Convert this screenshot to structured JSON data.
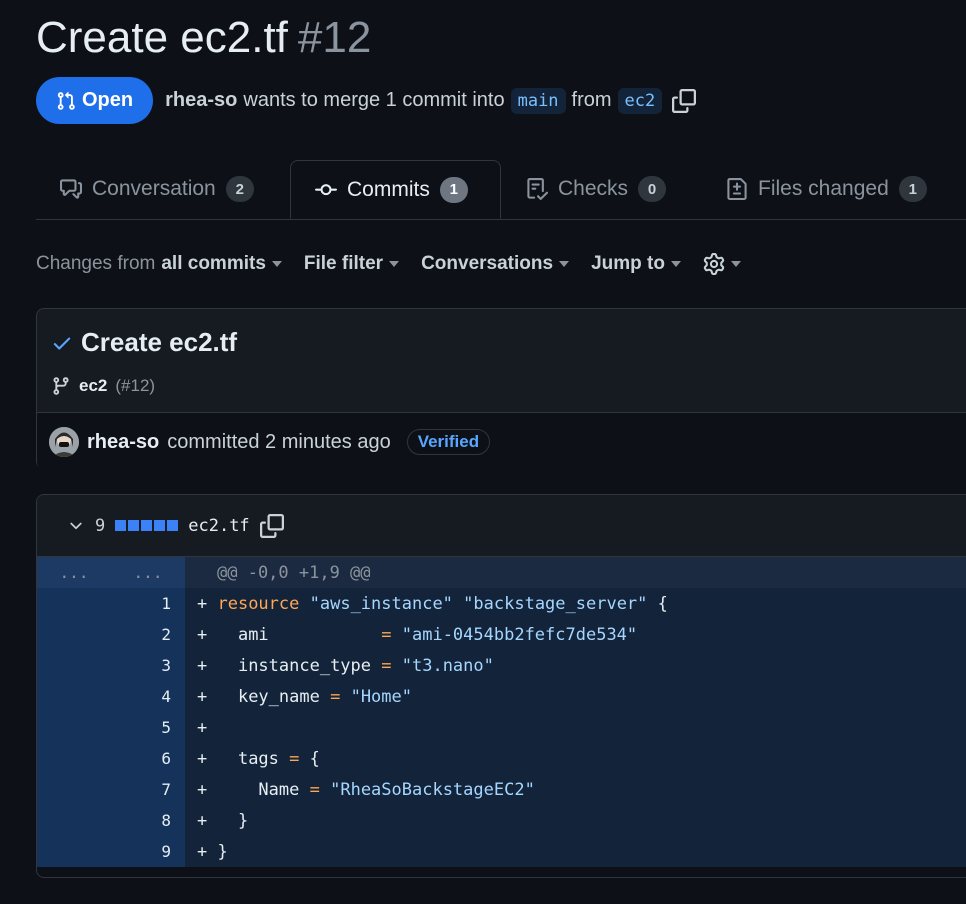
{
  "pr": {
    "title": "Create ec2.tf",
    "number": "#12",
    "state": "Open",
    "author": "rhea-so",
    "merge_text": "wants to merge 1 commit into",
    "base_branch": "main",
    "from_text": "from",
    "head_branch": "ec2"
  },
  "tabs": [
    {
      "label": "Conversation",
      "count": "2",
      "icon": "comment-icon"
    },
    {
      "label": "Commits",
      "count": "1",
      "icon": "commit-icon",
      "active": true
    },
    {
      "label": "Checks",
      "count": "0",
      "icon": "checklist-icon"
    },
    {
      "label": "Files changed",
      "count": "1",
      "icon": "file-diff-icon"
    }
  ],
  "filters": {
    "changes_prefix": "Changes from",
    "changes_value": "all commits",
    "file_filter": "File filter",
    "conversations": "Conversations",
    "jump_to": "Jump to"
  },
  "commit": {
    "title": "Create ec2.tf",
    "branch": "ec2",
    "pr_ref": "(#12)",
    "author": "rhea-so",
    "action": "committed 2 minutes ago",
    "badge": "Verified"
  },
  "file": {
    "changes": "9",
    "name": "ec2.tf",
    "hunk_old": "...",
    "hunk_new": "...",
    "hunk_header": "@@ -0,0 +1,9 @@",
    "lines": [
      {
        "n": "1",
        "prefix": "+ ",
        "text": "resource \"aws_instance\" \"backstage_server\" {"
      },
      {
        "n": "2",
        "prefix": "+   ",
        "text": "ami           = \"ami-0454bb2fefc7de534\""
      },
      {
        "n": "3",
        "prefix": "+   ",
        "text": "instance_type = \"t3.nano\""
      },
      {
        "n": "4",
        "prefix": "+   ",
        "text": "key_name = \"Home\""
      },
      {
        "n": "5",
        "prefix": "+",
        "text": ""
      },
      {
        "n": "6",
        "prefix": "+   ",
        "text": "tags = {"
      },
      {
        "n": "7",
        "prefix": "+     ",
        "text": "Name = \"RheaSoBackstageEC2\""
      },
      {
        "n": "8",
        "prefix": "+   ",
        "text": "}"
      },
      {
        "n": "9",
        "prefix": "+ ",
        "text": "}"
      }
    ]
  },
  "colors": {
    "accent": "#1f6feb",
    "added_line_bg": "#132339",
    "added_gutter_bg": "#14325a"
  }
}
